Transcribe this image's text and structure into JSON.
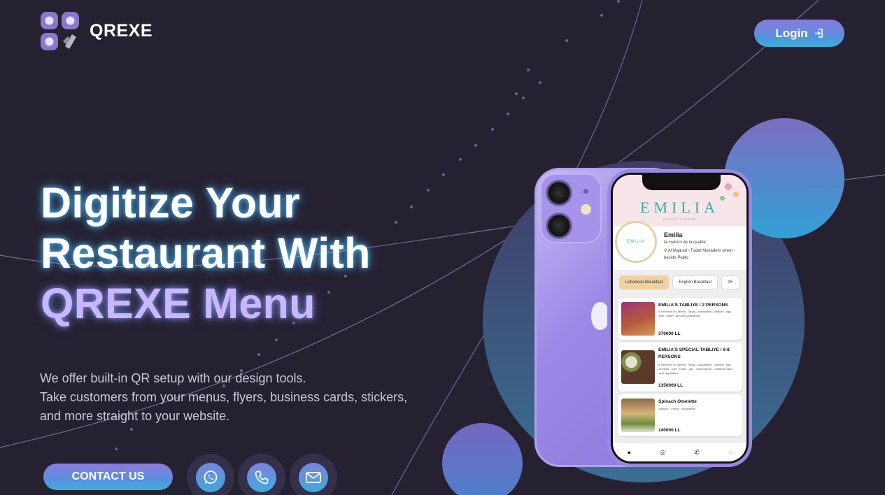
{
  "brand": {
    "name": "QREXE"
  },
  "header": {
    "login_label": "Login"
  },
  "hero": {
    "title_line1": "Digitize Your",
    "title_line2": "Restaurant With",
    "title_line3": "QREXE Menu",
    "desc_line1": "We offer built-in QR setup with our design tools.",
    "desc_line2": "Take customers from your menus, flyers, business cards, stickers,",
    "desc_line3": "and more straight to your website."
  },
  "actions": {
    "contact_label": "CONTACT US",
    "social": [
      {
        "icon": "whatsapp-icon"
      },
      {
        "icon": "phone-icon"
      },
      {
        "icon": "mail-icon"
      }
    ]
  },
  "phone_screen": {
    "banner_title": "EMILIA",
    "banner_subtitle": "COFFEE LOUNGE",
    "logo_text": "EMILIA",
    "restaurant_name": "Emilia",
    "tagline": "la maison de la qualité",
    "address": "Al Maarad - Fadel Mokadem street - beside Pablo",
    "tabs": [
      "Lebanese Breakfast",
      "English Breakfast",
      "AF"
    ],
    "items": [
      {
        "name": "EMILIA'S TABLIYE / 2 PERSONS",
        "desc": "A Selection of Labneh , Tahay , kashkawan , halloum , egg , olive , butter , jam and vegetables",
        "price": "370000 LL"
      },
      {
        "name": "EMILIA'S SPECIAL TABLIYE / 6-8 PERSONS",
        "desc": "A Selection of Labneh , Tahay , kashkawan , halloum , egg , omelette , olive , butter , jam , hommos&ful , Lebanese taba ,and vegetables",
        "price": "1350000 LL"
      },
      {
        "name": "Spinach Omelette",
        "desc": "Spinach , Creme , Mozzarella",
        "price": "140000 LL"
      }
    ]
  },
  "colors": {
    "background": "#262131",
    "accent_purple": "#8a7bdb",
    "accent_blue": "#38b2d9",
    "title_accent": "#c7b8ff"
  }
}
